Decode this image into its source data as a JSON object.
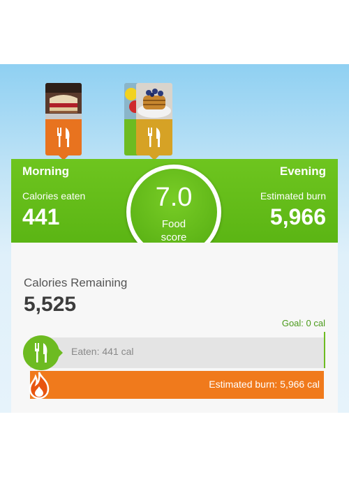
{
  "summary": {
    "morning_label": "Morning",
    "evening_label": "Evening",
    "calories_eaten_label": "Calories eaten",
    "calories_eaten_value": "441",
    "estimated_burn_label": "Estimated burn",
    "estimated_burn_value": "5,966",
    "food_score_value": "7.0",
    "food_score_label": "Food score"
  },
  "meals": [
    {
      "icon": "fork-knife-icon",
      "color": "#e8731f"
    },
    {
      "icon": "fork-knife-icon",
      "color": "#6dbb21"
    },
    {
      "icon": "fork-knife-icon",
      "color": "#d6a225"
    }
  ],
  "remaining": {
    "label": "Calories Remaining",
    "value": "5,525"
  },
  "goal": {
    "label": "Goal: 0 cal"
  },
  "bars": {
    "eaten_label": "Eaten: 441 cal",
    "burn_label": "Estimated burn: 5,966 cal"
  },
  "colors": {
    "green": "#6dbb21",
    "orange": "#f07a1c",
    "gold": "#d6a225"
  }
}
